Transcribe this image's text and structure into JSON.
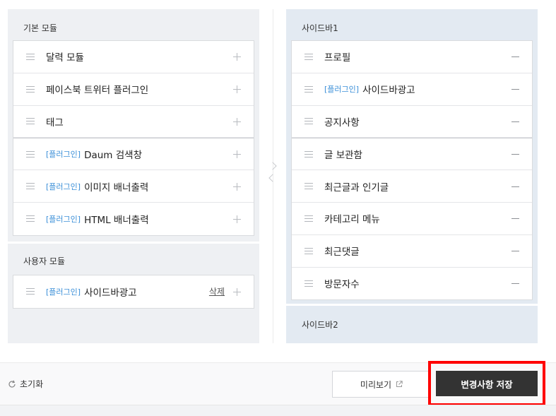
{
  "basic_modules": {
    "title": "기본 모듈",
    "items": [
      {
        "tag": "",
        "label": "달력 모듈"
      },
      {
        "tag": "",
        "label": "페이스북 트위터 플러그인"
      },
      {
        "tag": "",
        "label": "태그"
      },
      {
        "tag": "[플러그인]",
        "label": "Daum 검색창"
      },
      {
        "tag": "[플러그인]",
        "label": "이미지 배너출력"
      },
      {
        "tag": "[플러그인]",
        "label": "HTML 배너출력"
      }
    ]
  },
  "user_modules": {
    "title": "사용자 모듈",
    "items": [
      {
        "tag": "[플러그인]",
        "label": "사이드바광고",
        "delete_label": "삭제"
      }
    ]
  },
  "sidebar1": {
    "title": "사이드바1",
    "items": [
      {
        "tag": "",
        "label": "프로필"
      },
      {
        "tag": "[플러그인]",
        "label": "사이드바광고"
      },
      {
        "tag": "",
        "label": "공지사항"
      },
      {
        "tag": "",
        "label": "글 보관함"
      },
      {
        "tag": "",
        "label": "최근글과 인기글"
      },
      {
        "tag": "",
        "label": "카테고리 메뉴"
      },
      {
        "tag": "",
        "label": "최근댓글"
      },
      {
        "tag": "",
        "label": "방문자수"
      }
    ]
  },
  "sidebar2": {
    "title": "사이드바2"
  },
  "footer": {
    "reset_label": "초기화",
    "preview_label": "미리보기",
    "save_label": "변경사항 저장"
  },
  "icons": {
    "drag": "drag-handle-icon",
    "add": "plus-icon",
    "remove": "minus-icon",
    "reset": "refresh-icon",
    "external": "external-link-icon",
    "move": "chevron-icon"
  },
  "colors": {
    "plugin_tag": "#3b8fd8",
    "save_button": "#333333",
    "highlight": "#ff0000",
    "sidebar_bg": "#e3eaf2",
    "module_bg": "#eef0f3"
  }
}
